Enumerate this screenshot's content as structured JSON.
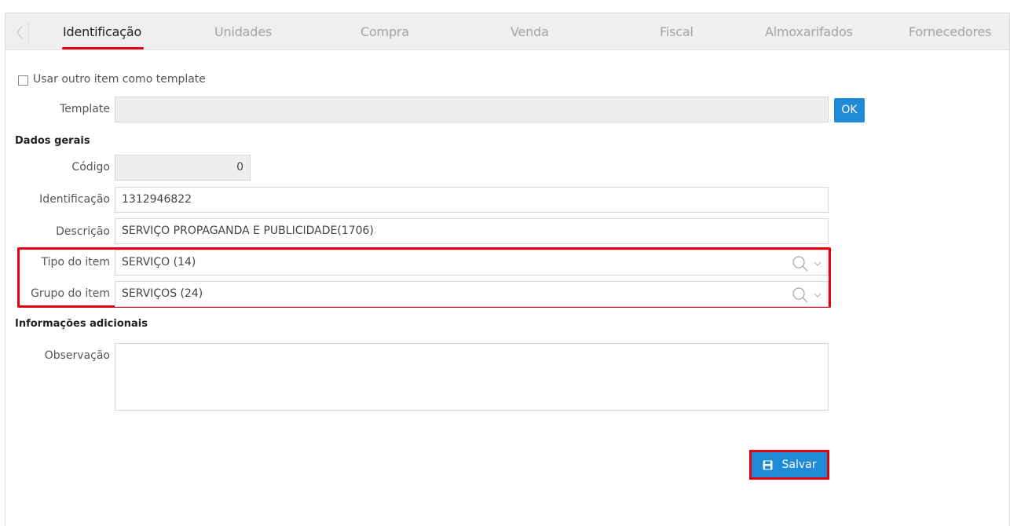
{
  "tabs": [
    {
      "label": "Identificação",
      "active": true
    },
    {
      "label": "Unidades",
      "active": false
    },
    {
      "label": "Compra",
      "active": false
    },
    {
      "label": "Venda",
      "active": false
    },
    {
      "label": "Fiscal",
      "active": false
    },
    {
      "label": "Almoxarifados",
      "active": false
    },
    {
      "label": "Fornecedores",
      "active": false
    }
  ],
  "template": {
    "checkbox_label": "Usar outro item como template",
    "checked": false,
    "label": "Template",
    "value": "",
    "ok_label": "OK"
  },
  "dados_gerais": {
    "title": "Dados gerais",
    "codigo_label": "Código",
    "codigo_value": "0",
    "identificacao_label": "Identificação",
    "identificacao_value": "1312946822",
    "descricao_label": "Descrição",
    "descricao_value": "SERVIÇO PROPAGANDA E PUBLICIDADE(1706)",
    "tipo_label": "Tipo do item",
    "tipo_value": "SERVIÇO (14)",
    "grupo_label": "Grupo do item",
    "grupo_value": "SERVIÇOS (24)"
  },
  "info_adicionais": {
    "title": "Informações adicionais",
    "observacao_label": "Observação",
    "observacao_value": ""
  },
  "save_label": "Salvar",
  "colors": {
    "accent": "#1f8ad6",
    "highlight": "#e3000f"
  },
  "icons": {
    "tab_prev": "chevron-left-icon",
    "search": "search-icon",
    "dropdown": "chevron-down-icon",
    "save": "save-icon"
  }
}
